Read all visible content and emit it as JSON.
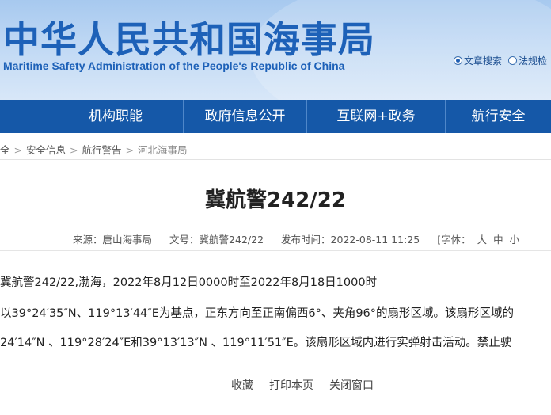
{
  "header": {
    "title_cn": "中华人民共和国海事局",
    "title_en": "Maritime Safety Administration of the People's Republic of China",
    "search_options": [
      {
        "label": "文章搜索",
        "selected": true
      },
      {
        "label": "法规检",
        "selected": false
      }
    ]
  },
  "nav": {
    "items": [
      "机构职能",
      "政府信息公开",
      "互联网+政务",
      "航行安全"
    ]
  },
  "breadcrumb": {
    "items": [
      "全",
      "安全信息",
      "航行警告",
      "河北海事局"
    ]
  },
  "article": {
    "title": "冀航警242/22",
    "source_label": "来源：",
    "source_value": "唐山海事局",
    "doc_label": "文号：",
    "doc_value": "冀航警242/22",
    "date_label": "发布时间：",
    "date_value": "2022-08-11 11:25",
    "font_label": "[字体：",
    "font_sizes": [
      "大",
      "中",
      "小"
    ],
    "paragraphs": [
      "冀航警242/22,渤海，2022年8月12日0000时至2022年8月18日1000时",
      "以39°24′35″N、119°13′44″E为基点，正东方向至正南偏西6°、夹角96°的扇形区域。该扇形区域的",
      "24′14″N 、119°28′24″E和39°13′13″N 、119°11′51″E。该扇形区域内进行实弹射击活动。禁止驶"
    ]
  },
  "actions": [
    "收藏",
    "打印本页",
    "关闭窗口"
  ],
  "colors": {
    "brand_blue": "#1d61b8",
    "nav_blue": "#1558a8",
    "banner_light": "#c4dbf5"
  }
}
